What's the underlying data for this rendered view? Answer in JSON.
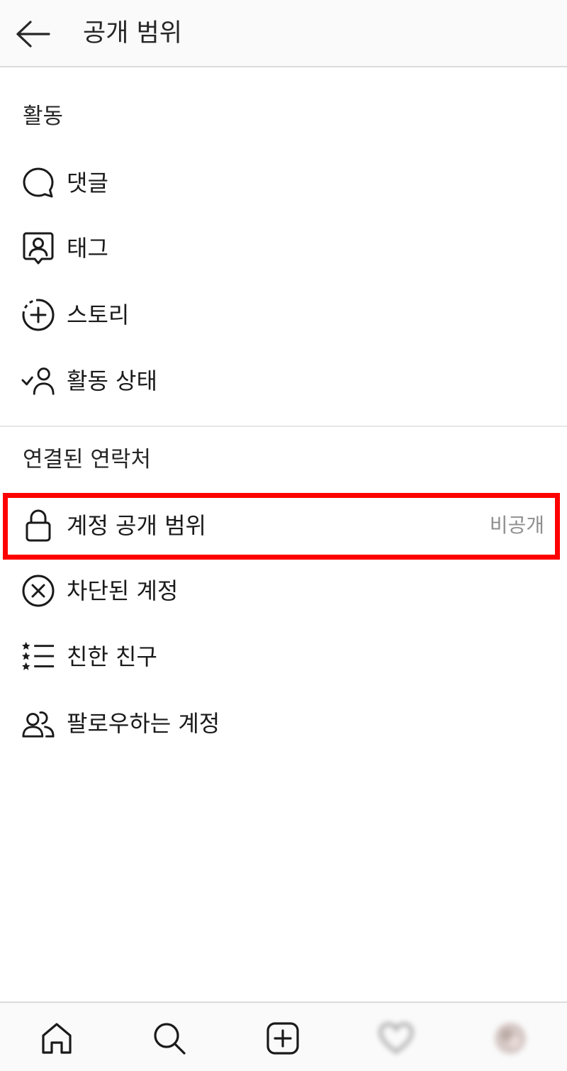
{
  "header": {
    "title": "공개 범위",
    "back_icon": "arrow-left-icon"
  },
  "sections": [
    {
      "title": "활동",
      "items": [
        {
          "label": "댓글",
          "icon": "comment-icon"
        },
        {
          "label": "태그",
          "icon": "tag-person-icon"
        },
        {
          "label": "스토리",
          "icon": "story-add-icon"
        },
        {
          "label": "활동 상태",
          "icon": "activity-status-icon"
        }
      ]
    },
    {
      "title": "연결된 연락처",
      "items": [
        {
          "label": "계정 공개 범위",
          "value": "비공개",
          "icon": "lock-icon",
          "highlighted": true
        },
        {
          "label": "차단된 계정",
          "icon": "blocked-x-icon"
        },
        {
          "label": "친한 친구",
          "icon": "close-friends-list-icon"
        },
        {
          "label": "팔로우하는 계정",
          "icon": "people-icon"
        }
      ]
    }
  ],
  "tabbar": {
    "tabs": [
      "home-icon",
      "search-icon",
      "add-post-icon",
      "activity-heart-icon",
      "profile-avatar-icon"
    ]
  },
  "colors": {
    "highlight": "#ff0000",
    "secondary_text": "#8e8e8e",
    "divider": "#dbdbdb"
  }
}
